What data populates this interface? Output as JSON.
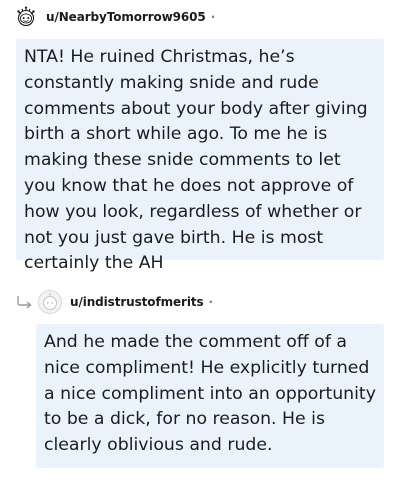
{
  "comments": [
    {
      "username": "u/NearbyTomorrow9605",
      "separator": "·",
      "body": "NTA! He ruined Christmas, he’s constantly making snide and rude comments about your body after giving birth a short while ago. To me he is making these snide comments to let you know that he does not approve of how you look, regardless of whether or not you just gave birth. He is most certainly the AH"
    },
    {
      "username": "u/indistrustofmerits",
      "separator": "·",
      "body": "And he made the comment off of a nice compliment! He explicitly turned a nice compliment into an opportunity to be a dick, for no reason. He is clearly oblivious and rude."
    }
  ],
  "icons": {
    "avatar_1": "snoo-avatar-icon",
    "reply_indicator": "reply-arrow-icon",
    "avatar_2": "default-avatar-icon"
  },
  "colors": {
    "bubble_background": "#eaf3fc",
    "text": "#1c1c1c",
    "meta": "#7c7c7c"
  }
}
